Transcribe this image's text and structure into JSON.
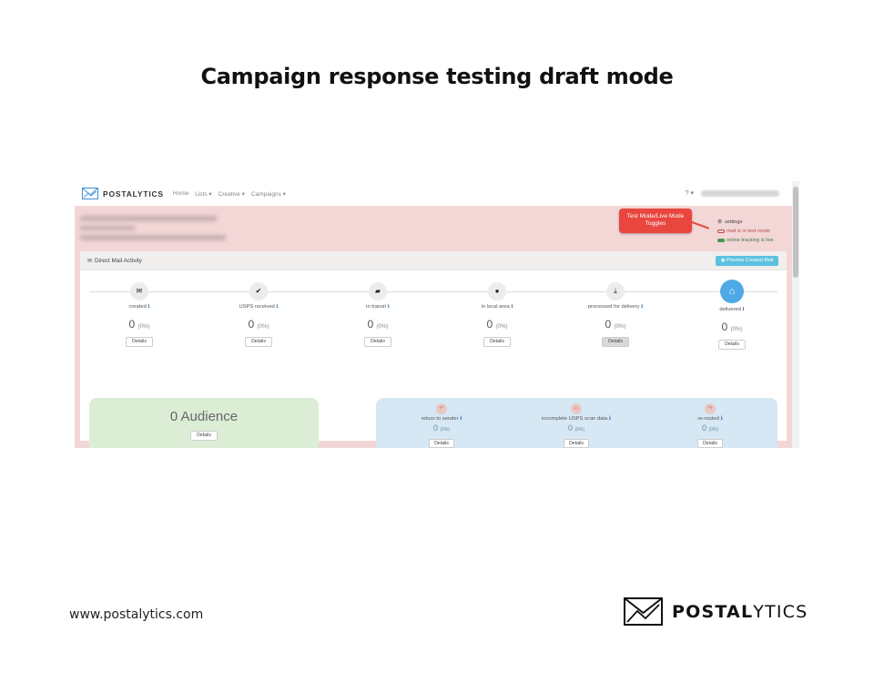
{
  "title": "Campaign response testing draft mode",
  "app": {
    "brand": "POSTALYTICS",
    "nav": [
      "Home",
      "Lists ▾",
      "Creative ▾",
      "Campaigns ▾"
    ],
    "help": "? ▾",
    "callout": "Test Mode/Live Mode Toggles",
    "modes": {
      "settings": "settings",
      "test": "mail is in test mode",
      "online": "online tracking is live"
    },
    "panel_title": "Direct Mail Activity",
    "preview_button": "Preview Created Mail",
    "stages": [
      {
        "label": "created",
        "count": "0",
        "pct": "(0%)",
        "details": "Details",
        "icon": "envelope-icon"
      },
      {
        "label": "USPS received",
        "count": "0",
        "pct": "(0%)",
        "details": "Details",
        "icon": "check-icon"
      },
      {
        "label": "in transit",
        "count": "0",
        "pct": "(0%)",
        "details": "Details",
        "icon": "truck-icon"
      },
      {
        "label": "in local area",
        "count": "0",
        "pct": "(0%)",
        "details": "Details",
        "icon": "map-pin-icon"
      },
      {
        "label": "processed for delivery",
        "count": "0",
        "pct": "(0%)",
        "details": "Details",
        "icon": "download-icon"
      },
      {
        "label": "delivered",
        "count": "0",
        "pct": "(0%)",
        "details": "Details",
        "icon": "home-icon"
      }
    ],
    "audience": {
      "count": "0 Audience",
      "details": "Details"
    },
    "returns": [
      {
        "label": "return to sender",
        "count": "0",
        "pct": "(0%)",
        "details": "Details",
        "icon": "undo-icon"
      },
      {
        "label": "incomplete USPS scan data",
        "count": "0",
        "pct": "(0%)",
        "details": "Details",
        "icon": "warning-icon"
      },
      {
        "label": "re-routed",
        "count": "0",
        "pct": "(0%)",
        "details": "Details",
        "icon": "redo-icon"
      }
    ]
  },
  "footer": {
    "url": "www.postalytics.com",
    "brand_bold": "POSTAL",
    "brand_light": "YTICS"
  }
}
